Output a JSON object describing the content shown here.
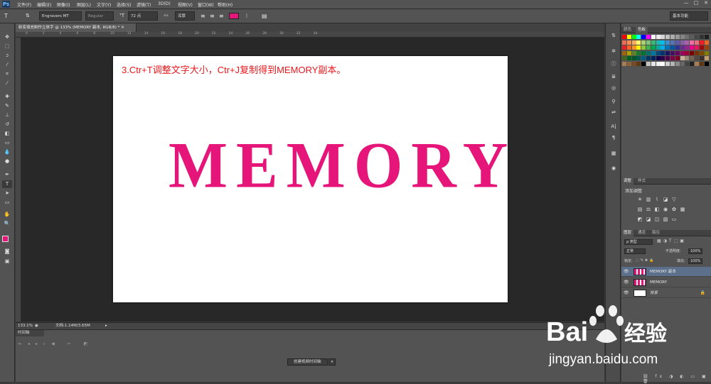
{
  "app": {
    "logo": "Ps"
  },
  "menu": [
    "文件(F)",
    "编辑(E)",
    "图像(I)",
    "图层(L)",
    "文字(Y)",
    "选择(S)",
    "滤镜(T)",
    "3D(D)",
    "视图(V)",
    "窗口(W)",
    "帮助(H)"
  ],
  "window_controls": [
    "—",
    "□",
    "✕"
  ],
  "options": {
    "tool_icon": "T",
    "font_family": "Engravers MT",
    "font_style": "Regular",
    "font_size": "72 点",
    "antialias": "浑厚",
    "color": "#e6157a",
    "workspace": "基本功能"
  },
  "document": {
    "tab_title": "新变填充制作立体字 @ 133% (MEMORY 副本, RGB/8) *",
    "caption": "3.Ctr+T调整文字大小，Ctr+J复制得到MEMORY副本。",
    "text": "MEMORY",
    "text_color": "#e6157a",
    "caption_color": "#e8181d"
  },
  "ruler_ticks": [
    "0",
    "2",
    "4",
    "6",
    "8",
    "10",
    "12",
    "14",
    "16",
    "18",
    "20",
    "22",
    "24",
    "26",
    "28",
    "30",
    "32",
    "34"
  ],
  "status": {
    "zoom": "133.1%",
    "doc": "文档:1.14M/3.65M"
  },
  "timeline": {
    "title": "时间轴",
    "create_button": "创建视频时间轴"
  },
  "panels": {
    "color_tabs": [
      "颜色",
      "色板"
    ],
    "adjust_tabs": [
      "调整",
      "样式"
    ],
    "adjust_title": "添加调整",
    "layer_tabs": [
      "图层",
      "通道",
      "路径"
    ],
    "kind": "ρ 类型",
    "blend_mode": "正常",
    "opacity_label": "不透明度:",
    "opacity": "100%",
    "lock_label": "锁定:",
    "fill_label": "填充:",
    "fill": "100%",
    "layers": [
      {
        "name": "MEMORY 副本",
        "selected": true
      },
      {
        "name": "MEMORY",
        "selected": false
      },
      {
        "name": "背景",
        "selected": false
      }
    ]
  },
  "watermark": {
    "brand": "Bai",
    "brand2": "经验",
    "url": "jingyan.baidu.com"
  }
}
